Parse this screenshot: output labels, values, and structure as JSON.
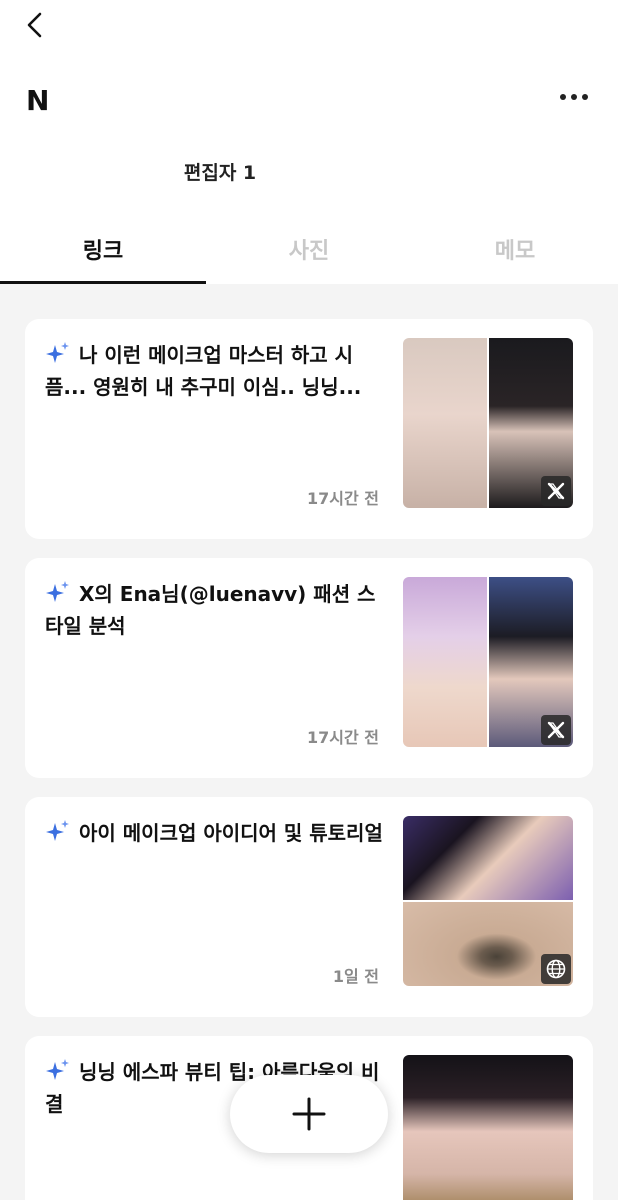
{
  "header": {
    "title": "N",
    "editors": "편집자 1"
  },
  "tabs": [
    {
      "label": "링크",
      "active": true
    },
    {
      "label": "사진",
      "active": false
    },
    {
      "label": "메모",
      "active": false
    }
  ],
  "links": [
    {
      "title": "나 이런 메이크업 마스터 하고 시픔... 영원히 내 추구미 이심.. 닝닝...",
      "time": "17시간 전",
      "source_icon": "x-logo-icon"
    },
    {
      "title": "X의 Ena님(@luenavv) 패션 스타일 분석",
      "time": "17시간 전",
      "source_icon": "x-logo-icon"
    },
    {
      "title": "아이 메이크업 아이디어 및 튜토리얼",
      "time": "1일 전",
      "source_icon": "globe-icon"
    },
    {
      "title": "닝닝 에스파 뷰티 팁: 아름다움의 비결",
      "time": "",
      "source_icon": "x-logo-icon"
    }
  ],
  "colors": {
    "accent_sparkle": "#3b6fe0",
    "background": "#f4f4f4",
    "card": "#ffffff",
    "inactive_tab": "#c8c8c8"
  }
}
